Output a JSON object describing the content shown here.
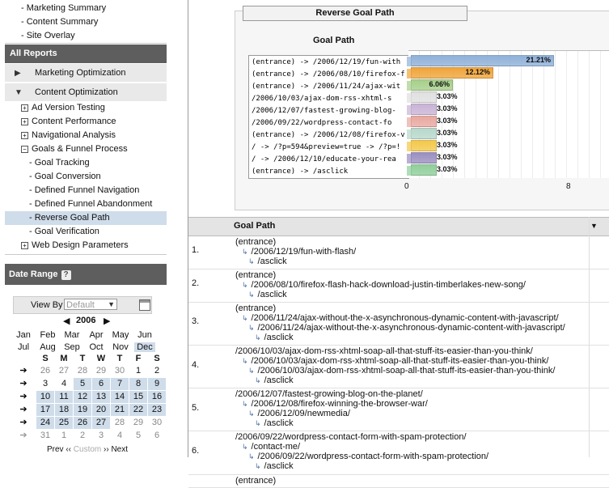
{
  "sidebar": {
    "top_links": [
      "- Marketing Summary",
      "- Content Summary",
      "- Site Overlay"
    ],
    "all_reports": "All Reports",
    "sections": [
      {
        "label": "Marketing Optimization",
        "expanded": false
      },
      {
        "label": "Content Optimization",
        "expanded": true
      }
    ],
    "tree": [
      {
        "label": "Ad Version Testing",
        "box": "+"
      },
      {
        "label": "Content Performance",
        "box": "+"
      },
      {
        "label": "Navigational Analysis",
        "box": "+"
      },
      {
        "label": "Goals & Funnel Process",
        "box": "−"
      }
    ],
    "sub_items": [
      "- Goal Tracking",
      "- Goal Conversion",
      "- Defined Funnel Navigation",
      "- Defined Funnel Abandonment",
      "- Reverse Goal Path",
      "- Goal Verification"
    ],
    "selected_sub": "- Reverse Goal Path",
    "web_design": {
      "label": "Web Design Parameters",
      "box": "+"
    }
  },
  "date_range": {
    "title": "Date Range",
    "help": "?",
    "view_by_label": "View By",
    "view_by_value": "Default",
    "year": "2006",
    "year_prev": "◀",
    "year_next": "▶",
    "months": [
      "Jan",
      "Feb",
      "Mar",
      "Apr",
      "May",
      "Jun",
      "Jul",
      "Aug",
      "Sep",
      "Oct",
      "Nov",
      "Dec"
    ],
    "selected_month": "Dec",
    "weekdays": [
      "S",
      "M",
      "T",
      "W",
      "T",
      "F",
      "S"
    ],
    "weeks": [
      [
        "26",
        "27",
        "28",
        "29",
        "30",
        "1",
        "2"
      ],
      [
        "3",
        "4",
        "5",
        "6",
        "7",
        "8",
        "9"
      ],
      [
        "10",
        "11",
        "12",
        "13",
        "14",
        "15",
        "16"
      ],
      [
        "17",
        "18",
        "19",
        "20",
        "21",
        "22",
        "23"
      ],
      [
        "24",
        "25",
        "26",
        "27",
        "28",
        "29",
        "30"
      ],
      [
        "31",
        "1",
        "2",
        "3",
        "4",
        "5",
        "6"
      ]
    ],
    "prev": "Prev",
    "custom": "Custom",
    "next": "Next",
    "prev_glyph": "‹‹",
    "next_glyph": "››"
  },
  "chart": {
    "box_title": "Reverse Goal Path",
    "plot_title": "Goal Path",
    "x_ticks": [
      "0",
      "8"
    ]
  },
  "chart_data": {
    "type": "bar",
    "title": "Goal Path",
    "orientation": "horizontal",
    "categories": [
      "(entrance) -> /2006/12/19/fun-with",
      "(entrance) -> /2006/08/10/firefox-f",
      "(entrance) -> /2006/11/24/ajax-wit",
      "/2006/10/03/ajax-dom-rss-xhtml-s",
      "/2006/12/07/fastest-growing-blog-",
      "/2006/09/22/wordpress-contact-fo",
      "(entrance) -> /2006/12/08/firefox-v",
      "/ -> /?p=594&preview=true -> /?p=!",
      "/ -> /2006/12/10/educate-your-rea",
      "(entrance) -> /asclick"
    ],
    "values": [
      21.21,
      12.12,
      6.06,
      3.03,
      3.03,
      3.03,
      3.03,
      3.03,
      3.03,
      3.03
    ],
    "value_labels": [
      "21.21%",
      "12.12%",
      "6.06%",
      "3.03%",
      "3.03%",
      "3.03%",
      "3.03%",
      "3.03%",
      "3.03%",
      "3.03%"
    ],
    "colors": [
      "#8fb0d8",
      "#f0a43a",
      "#a6cf8a",
      "#e0e0e0",
      "#c9b3d6",
      "#e8a8a0",
      "#b8d8cc",
      "#f3c84a",
      "#9a8fc0",
      "#8fcf9a"
    ],
    "xlim": [
      0,
      8
    ]
  },
  "table": {
    "header": "Goal Path",
    "sort_glyph": "▼",
    "rows": [
      {
        "num": "1.",
        "lines": [
          "(entrance)",
          "/2006/12/19/fun-with-flash/",
          "/asclick"
        ]
      },
      {
        "num": "2.",
        "lines": [
          "(entrance)",
          "/2006/08/10/firefox-flash-hack-download-justin-timberlakes-new-song/",
          "/asclick"
        ]
      },
      {
        "num": "3.",
        "lines": [
          "(entrance)",
          "/2006/11/24/ajax-without-the-x-asynchronous-dynamic-content-with-javascript/",
          "/2006/11/24/ajax-without-the-x-asynchronous-dynamic-content-with-javascript/",
          "/asclick"
        ]
      },
      {
        "num": "4.",
        "lines": [
          "/2006/10/03/ajax-dom-rss-xhtml-soap-all-that-stuff-its-easier-than-you-think/",
          "/2006/10/03/ajax-dom-rss-xhtml-soap-all-that-stuff-its-easier-than-you-think/",
          "/2006/10/03/ajax-dom-rss-xhtml-soap-all-that-stuff-its-easier-than-you-think/",
          "/asclick"
        ]
      },
      {
        "num": "5.",
        "lines": [
          "/2006/12/07/fastest-growing-blog-on-the-planet/",
          "/2006/12/08/firefox-winning-the-browser-war/",
          "/2006/12/09/newmedia/",
          "/asclick"
        ]
      },
      {
        "num": "6.",
        "lines": [
          "/2006/09/22/wordpress-contact-form-with-spam-protection/",
          "/contact-me/",
          "/2006/09/22/wordpress-contact-form-with-spam-protection/",
          "/asclick"
        ]
      },
      {
        "num": "",
        "lines": [
          "(entrance)"
        ]
      }
    ]
  }
}
